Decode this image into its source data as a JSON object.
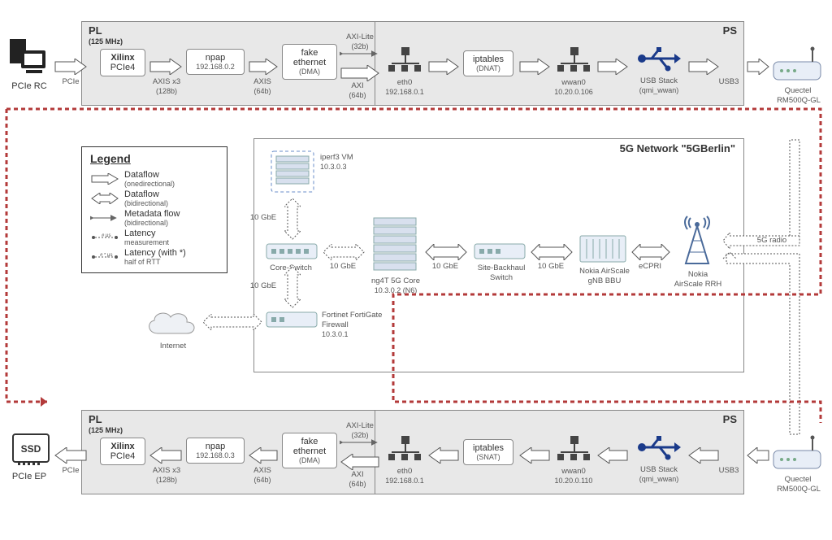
{
  "top_rail": {
    "pl": {
      "title": "PL",
      "sub": "(125 MHz)",
      "pcie_rc_label": "PCIe RC",
      "conn_pcie": "PCIe",
      "xilinx": {
        "l1": "Xilinx",
        "l2": "PCIe4"
      },
      "axis_x3": "AXIS x3",
      "axis_x3_sub": "(128b)",
      "npap": {
        "name": "npap",
        "ip": "192.168.0.2"
      },
      "axis_label": "AXIS",
      "axis_sub": "(64b)",
      "fake_eth": {
        "l1": "fake",
        "l2": "ethernet",
        "l3": "(DMA)"
      },
      "axi_lite": "AXI-Lite",
      "axi_lite_sub": "(32b)",
      "axi": "AXI",
      "axi_sub": "(64b)"
    },
    "ps": {
      "title": "PS",
      "eth0": {
        "name": "eth0",
        "ip": "192.168.0.1"
      },
      "iptables": {
        "name": "iptables",
        "mode": "(DNAT)"
      },
      "wwan0": {
        "name": "wwan0",
        "ip": "10.20.0.106"
      },
      "usb": {
        "name": "USB Stack",
        "sub": "(qmi_wwan)"
      },
      "usb3": "USB3"
    },
    "modem": {
      "l1": "Quectel",
      "l2": "RM500Q-GL"
    }
  },
  "bottom_rail": {
    "pl": {
      "title": "PL",
      "sub": "(125 MHz)",
      "pcie_ep_label": "PCIe EP",
      "ssd": "SSD",
      "conn_pcie": "PCIe",
      "xilinx": {
        "l1": "Xilinx",
        "l2": "PCIe4"
      },
      "axis_x3": "AXIS x3",
      "axis_x3_sub": "(128b)",
      "npap": {
        "name": "npap",
        "ip": "192.168.0.3"
      },
      "axis_label": "AXIS",
      "axis_sub": "(64b)",
      "fake_eth": {
        "l1": "fake",
        "l2": "ethernet",
        "l3": "(DMA)"
      },
      "axi_lite": "AXI-Lite",
      "axi_lite_sub": "(32b)",
      "axi": "AXI",
      "axi_sub": "(64b)"
    },
    "ps": {
      "title": "PS",
      "eth0": {
        "name": "eth0",
        "ip": "192.168.0.1"
      },
      "iptables": {
        "name": "iptables",
        "mode": "(SNAT)"
      },
      "wwan0": {
        "name": "wwan0",
        "ip": "10.20.0.110"
      },
      "usb": {
        "name": "USB Stack",
        "sub": "(qmi_wwan)"
      },
      "usb3": "USB3"
    },
    "modem": {
      "l1": "Quectel",
      "l2": "RM500Q-GL"
    }
  },
  "mid": {
    "title": "5G Network \"5GBerlin\"",
    "iperf": {
      "name": "iperf3 VM",
      "ip": "10.3.0.3"
    },
    "core_switch": "Core-Switch",
    "fortigate": {
      "l1": "Fortinet FortiGate",
      "l2": "Firewall",
      "ip": "10.3.0.1"
    },
    "ng4t": {
      "name": "ng4T 5G Core",
      "ip": "10.3.0.2 (N6)"
    },
    "site_backhaul": {
      "l1": "Site-Backhaul",
      "l2": "Switch"
    },
    "gnb": {
      "l1": "Nokia AirScale",
      "l2": "gNB BBU"
    },
    "rrh": {
      "l1": "Nokia",
      "l2": "AirScale RRH"
    },
    "link_10gbe": "10 GbE",
    "link_ecpri": "eCPRI",
    "link_5gradio": "5G radio",
    "internet": "Internet"
  },
  "legend": {
    "title": "Legend",
    "dataflow_one": "Dataflow",
    "dataflow_one_sub": "(onedirectional)",
    "dataflow_bi": "Dataflow",
    "dataflow_bi_sub": "(bidirectional)",
    "metadata": "Metadata flow",
    "metadata_sub": "(bidirectional)",
    "latency": "Latency",
    "latency_sub": "measurement",
    "latency_half": "Latency (with *)",
    "latency_half_sub": "half of RTT",
    "mu_hash": "# μs",
    "mu_star": "# * μs"
  }
}
